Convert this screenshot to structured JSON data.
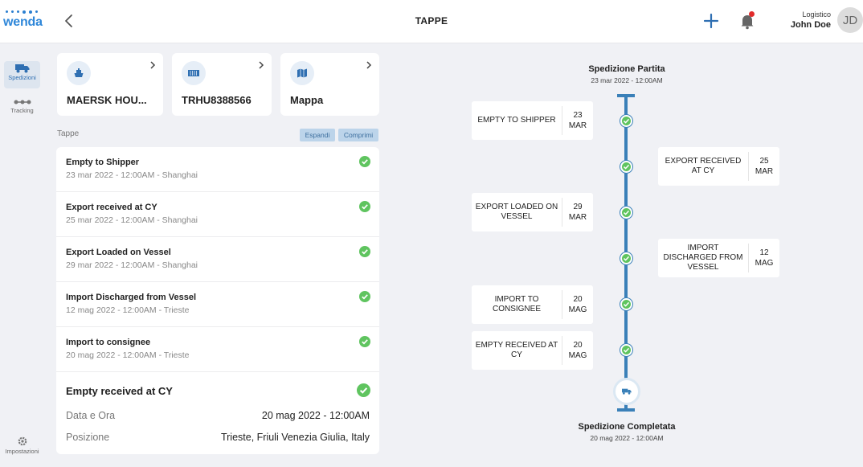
{
  "header": {
    "logo_text": "wenda",
    "title": "TAPPE",
    "user_role": "Logistico",
    "user_name": "John Doe",
    "avatar_initials": "JD"
  },
  "sidebar": {
    "items": [
      {
        "label": "Spedizioni",
        "icon": "truck-icon",
        "active": true
      },
      {
        "label": "Tracking",
        "icon": "tracking-icon",
        "active": false
      },
      {
        "label": "Impostazioni",
        "icon": "gear-icon",
        "active": false
      }
    ]
  },
  "cards": [
    {
      "label": "MAERSK HOU...",
      "icon": "ship-icon"
    },
    {
      "label": "TRHU8388566",
      "icon": "container-icon"
    },
    {
      "label": "Mappa",
      "icon": "map-icon"
    }
  ],
  "stages": {
    "section_label": "Tappe",
    "expand_label": "Espandi",
    "collapse_label": "Comprimi",
    "items": [
      {
        "title": "Empty to Shipper",
        "subtitle": "23 mar 2022 - 12:00AM - Shanghai"
      },
      {
        "title": "Export received at CY",
        "subtitle": "25 mar 2022 - 12:00AM - Shanghai"
      },
      {
        "title": "Export Loaded on Vessel",
        "subtitle": "29 mar 2022 - 12:00AM - Shanghai"
      },
      {
        "title": "Import Discharged from Vessel",
        "subtitle": "12 mag 2022 - 12:00AM - Trieste"
      },
      {
        "title": "Import to consignee",
        "subtitle": "20 mag 2022 - 12:00AM - Trieste"
      }
    ],
    "detail": {
      "title": "Empty received at CY",
      "date_label": "Data e Ora",
      "date_value": "20 mag 2022 - 12:00AM",
      "position_label": "Posizione",
      "position_value": "Trieste, Friuli Venezia Giulia, Italy"
    }
  },
  "timeline": {
    "start_title": "Spedizione Partita",
    "start_date": "23 mar 2022 - 12:00AM",
    "end_title": "Spedizione Completata",
    "end_date": "20 mag 2022 - 12:00AM",
    "events": [
      {
        "name": "EMPTY TO SHIPPER",
        "day": "23",
        "month": "MAR",
        "side": "left"
      },
      {
        "name": "EXPORT RECEIVED AT CY",
        "day": "25",
        "month": "MAR",
        "side": "right"
      },
      {
        "name": "EXPORT LOADED ON VESSEL",
        "day": "29",
        "month": "MAR",
        "side": "left"
      },
      {
        "name": "IMPORT DISCHARGED FROM VESSEL",
        "day": "12",
        "month": "MAG",
        "side": "right"
      },
      {
        "name": "IMPORT TO CONSIGNEE",
        "day": "20",
        "month": "MAG",
        "side": "left"
      },
      {
        "name": "EMPTY RECEIVED AT CY",
        "day": "20",
        "month": "MAG",
        "side": "left"
      }
    ]
  },
  "colors": {
    "brand": "#2f87d9",
    "timeline": "#3a80b8",
    "success": "#5fc45f",
    "notification": "#e22b2b"
  }
}
